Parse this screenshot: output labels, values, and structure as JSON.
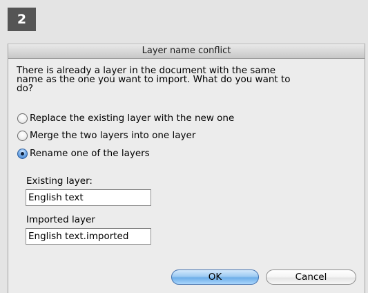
{
  "step_badge": "2",
  "dialog": {
    "title": "Layer name conflict",
    "message_lines": [
      "There is already a layer in the document with the same",
      "name as the one you want to import. What do you want to",
      "do?"
    ],
    "options": [
      {
        "label": "Replace the existing layer with the new one",
        "selected": false
      },
      {
        "label": "Merge the two layers into one layer",
        "selected": false
      },
      {
        "label": "Rename one of the layers",
        "selected": true
      }
    ],
    "existing_layer": {
      "label": "Existing layer:",
      "value": "English text"
    },
    "imported_layer": {
      "label": "Imported layer",
      "value": "English text.imported"
    },
    "buttons": {
      "ok": "OK",
      "cancel": "Cancel"
    }
  }
}
